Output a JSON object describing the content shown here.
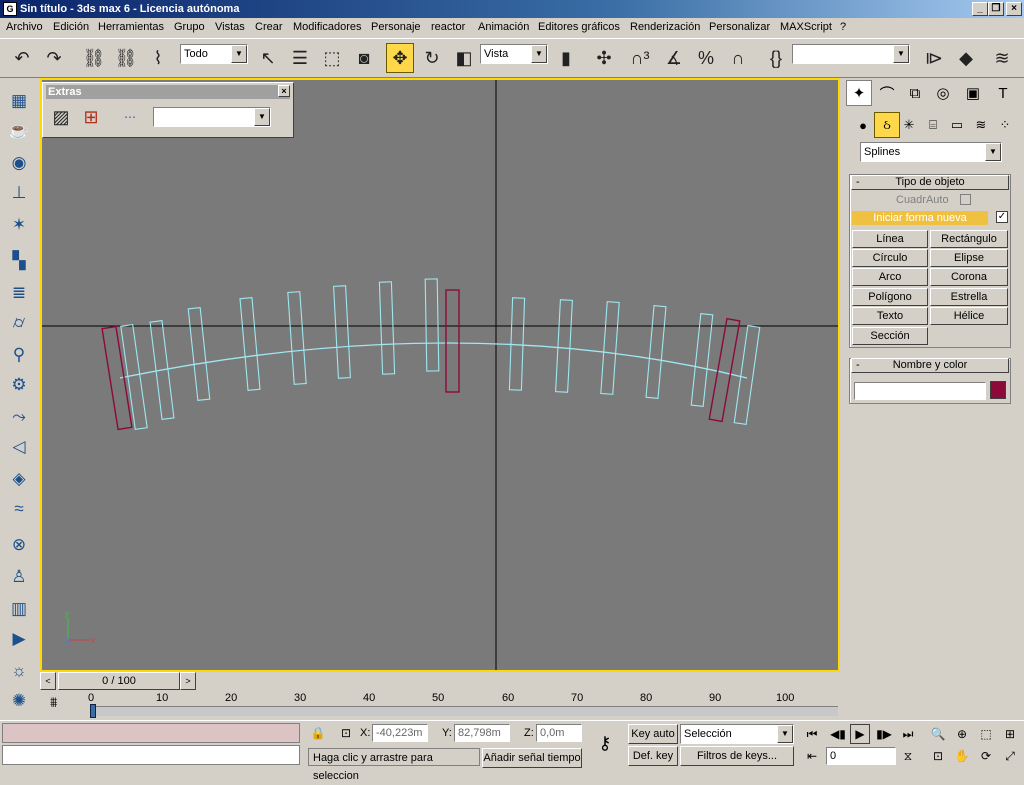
{
  "window": {
    "title": "Sin título - 3ds max 6 - Licencia autónoma",
    "app_icon": "3ds-max-icon"
  },
  "menu": [
    {
      "label": "Archivo"
    },
    {
      "label": "Edición"
    },
    {
      "label": "Herramientas"
    },
    {
      "label": "Grupo"
    },
    {
      "label": "Vistas"
    },
    {
      "label": "Crear"
    },
    {
      "label": "Modificadores"
    },
    {
      "label": "Personaje"
    },
    {
      "label": "reactor"
    },
    {
      "label": "Animación"
    },
    {
      "label": "Editores gráficos"
    },
    {
      "label": "Renderización"
    },
    {
      "label": "Personalizar"
    },
    {
      "label": "MAXScript"
    },
    {
      "label": "?"
    }
  ],
  "toolbar": {
    "selection_filter": "Todo",
    "reference_coord": "Vista",
    "named_selection": ""
  },
  "extras": {
    "title": "Extras",
    "dropdown_value": ""
  },
  "time_slider": {
    "frame_label": "0 / 100"
  },
  "track": {
    "ticks": [
      "0",
      "10",
      "20",
      "30",
      "40",
      "50",
      "60",
      "70",
      "80",
      "90",
      "100"
    ]
  },
  "command_panel": {
    "category": "Splines",
    "rollout_object_type": "Tipo de objeto",
    "autogrid_label": "CuadrAuto",
    "start_new_shape": "Iniciar forma nueva",
    "buttons": [
      "Línea",
      "Rectángulo",
      "Círculo",
      "Elipse",
      "Arco",
      "Corona",
      "Polígono",
      "Estrella",
      "Texto",
      "Hélice",
      "Sección"
    ],
    "rollout_name_color": "Nombre y color",
    "name_value": "",
    "color": "#8b0a3a"
  },
  "status": {
    "x_label": "X:",
    "x_value": "-40,223m",
    "y_label": "Y:",
    "y_value": "82,798m",
    "z_label": "Z:",
    "z_value": "0,0m",
    "prompt": "Haga clic y arrastre para seleccion",
    "add_time_tag": "Añadir señal tiempo",
    "key_auto": "Key auto",
    "def_key": "Def. key",
    "key_filter_value": "Selección",
    "key_filters": "Filtros de keys...",
    "current_frame": "0"
  },
  "colors": {
    "viewport_border": "#ffd800",
    "spline_cyan": "#9ee8f0",
    "selected_rect": "#8b0a3a",
    "active_tool": "#ffd84a"
  }
}
